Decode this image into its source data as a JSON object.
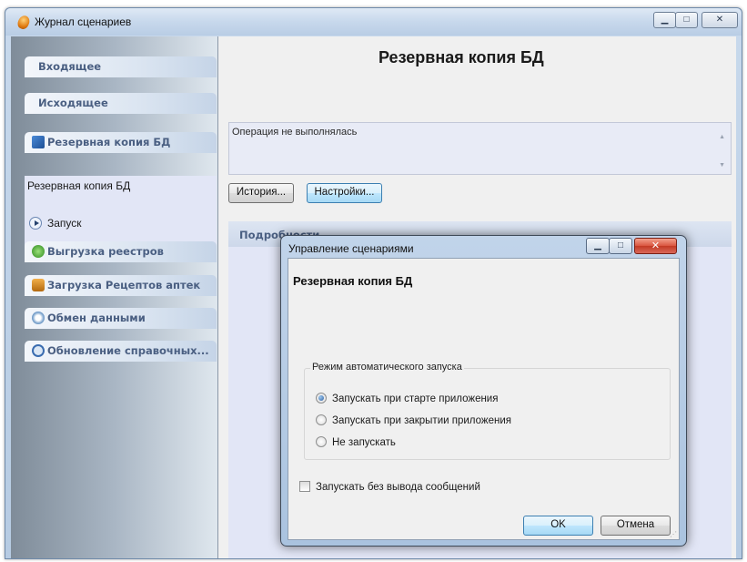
{
  "window": {
    "title": "Журнал сценариев",
    "minimize_label": "▁",
    "maximize_label": "□",
    "close_label": "✕"
  },
  "sidebar": {
    "incoming": "Входящее",
    "outgoing": "Исходящее",
    "backup": {
      "title": "Резервная копия БД",
      "link": "Резервная копия БД",
      "run": "Запуск"
    },
    "export": "Выгрузка реестров",
    "import": "Загрузка Рецептов аптек",
    "exchange": "Обмен данными",
    "refresh": "Обновление справочных..."
  },
  "main": {
    "title": "Резервная копия БД",
    "status": "Операция не выполнялась",
    "history_button": "История...",
    "settings_button": "Настройки...",
    "details_header": "Подробности"
  },
  "dialog": {
    "title": "Управление сценариями",
    "minimize_label": "▁",
    "maximize_label": "□",
    "close_label": "✕",
    "heading": "Резервная копия БД",
    "group_label": "Режим автоматического запуска",
    "options": [
      "Запускать при старте приложения",
      "Запускать при закрытии приложения",
      "Не запускать"
    ],
    "selected_option": 0,
    "silent_label": "Запускать без вывода сообщений",
    "silent_checked": false,
    "ok": "OK",
    "cancel": "Отмена"
  }
}
